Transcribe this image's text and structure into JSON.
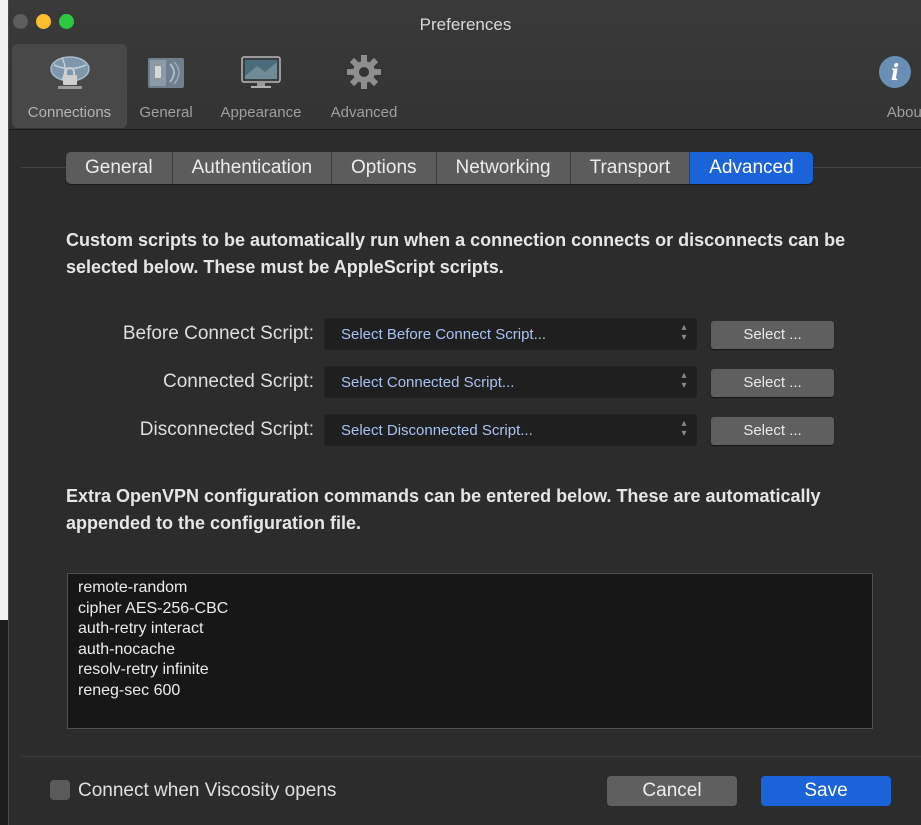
{
  "window": {
    "title": "Preferences"
  },
  "toolbar": {
    "items": [
      {
        "label": "Connections",
        "icon": "globe-network-icon",
        "selected": true
      },
      {
        "label": "General",
        "icon": "light-switch-icon",
        "selected": false
      },
      {
        "label": "Appearance",
        "icon": "monitor-icon",
        "selected": false
      },
      {
        "label": "Advanced",
        "icon": "gear-icon",
        "selected": false
      }
    ],
    "about": {
      "label": "About",
      "icon": "info-icon"
    }
  },
  "tabs": [
    {
      "label": "General",
      "active": false
    },
    {
      "label": "Authentication",
      "active": false
    },
    {
      "label": "Options",
      "active": false
    },
    {
      "label": "Networking",
      "active": false
    },
    {
      "label": "Transport",
      "active": false
    },
    {
      "label": "Advanced",
      "active": true
    }
  ],
  "scripts": {
    "description": "Custom scripts to be automatically run when a connection connects or disconnects can be selected below. These must be AppleScript scripts.",
    "rows": [
      {
        "label": "Before Connect Script:",
        "popup": "Select Before Connect Script...",
        "button": "Select ..."
      },
      {
        "label": "Connected Script:",
        "popup": "Select Connected Script...",
        "button": "Select ..."
      },
      {
        "label": "Disconnected Script:",
        "popup": "Select Disconnected Script...",
        "button": "Select ..."
      }
    ]
  },
  "config": {
    "description": "Extra OpenVPN configuration commands can be entered below. These are automatically appended to the configuration file.",
    "lines": [
      "remote-random",
      "cipher AES-256-CBC",
      "auth-retry interact",
      "auth-nocache",
      "resolv-retry infinite",
      "reneg-sec 600"
    ]
  },
  "footer": {
    "checkbox_label": "Connect when Viscosity opens",
    "checked": false,
    "cancel": "Cancel",
    "save": "Save"
  },
  "colors": {
    "accent": "#1a63d9",
    "window_bg": "#2c2c2c",
    "field_bg": "#1f1f1f",
    "traffic_yellow": "#febc2e",
    "traffic_green": "#2bc840"
  }
}
